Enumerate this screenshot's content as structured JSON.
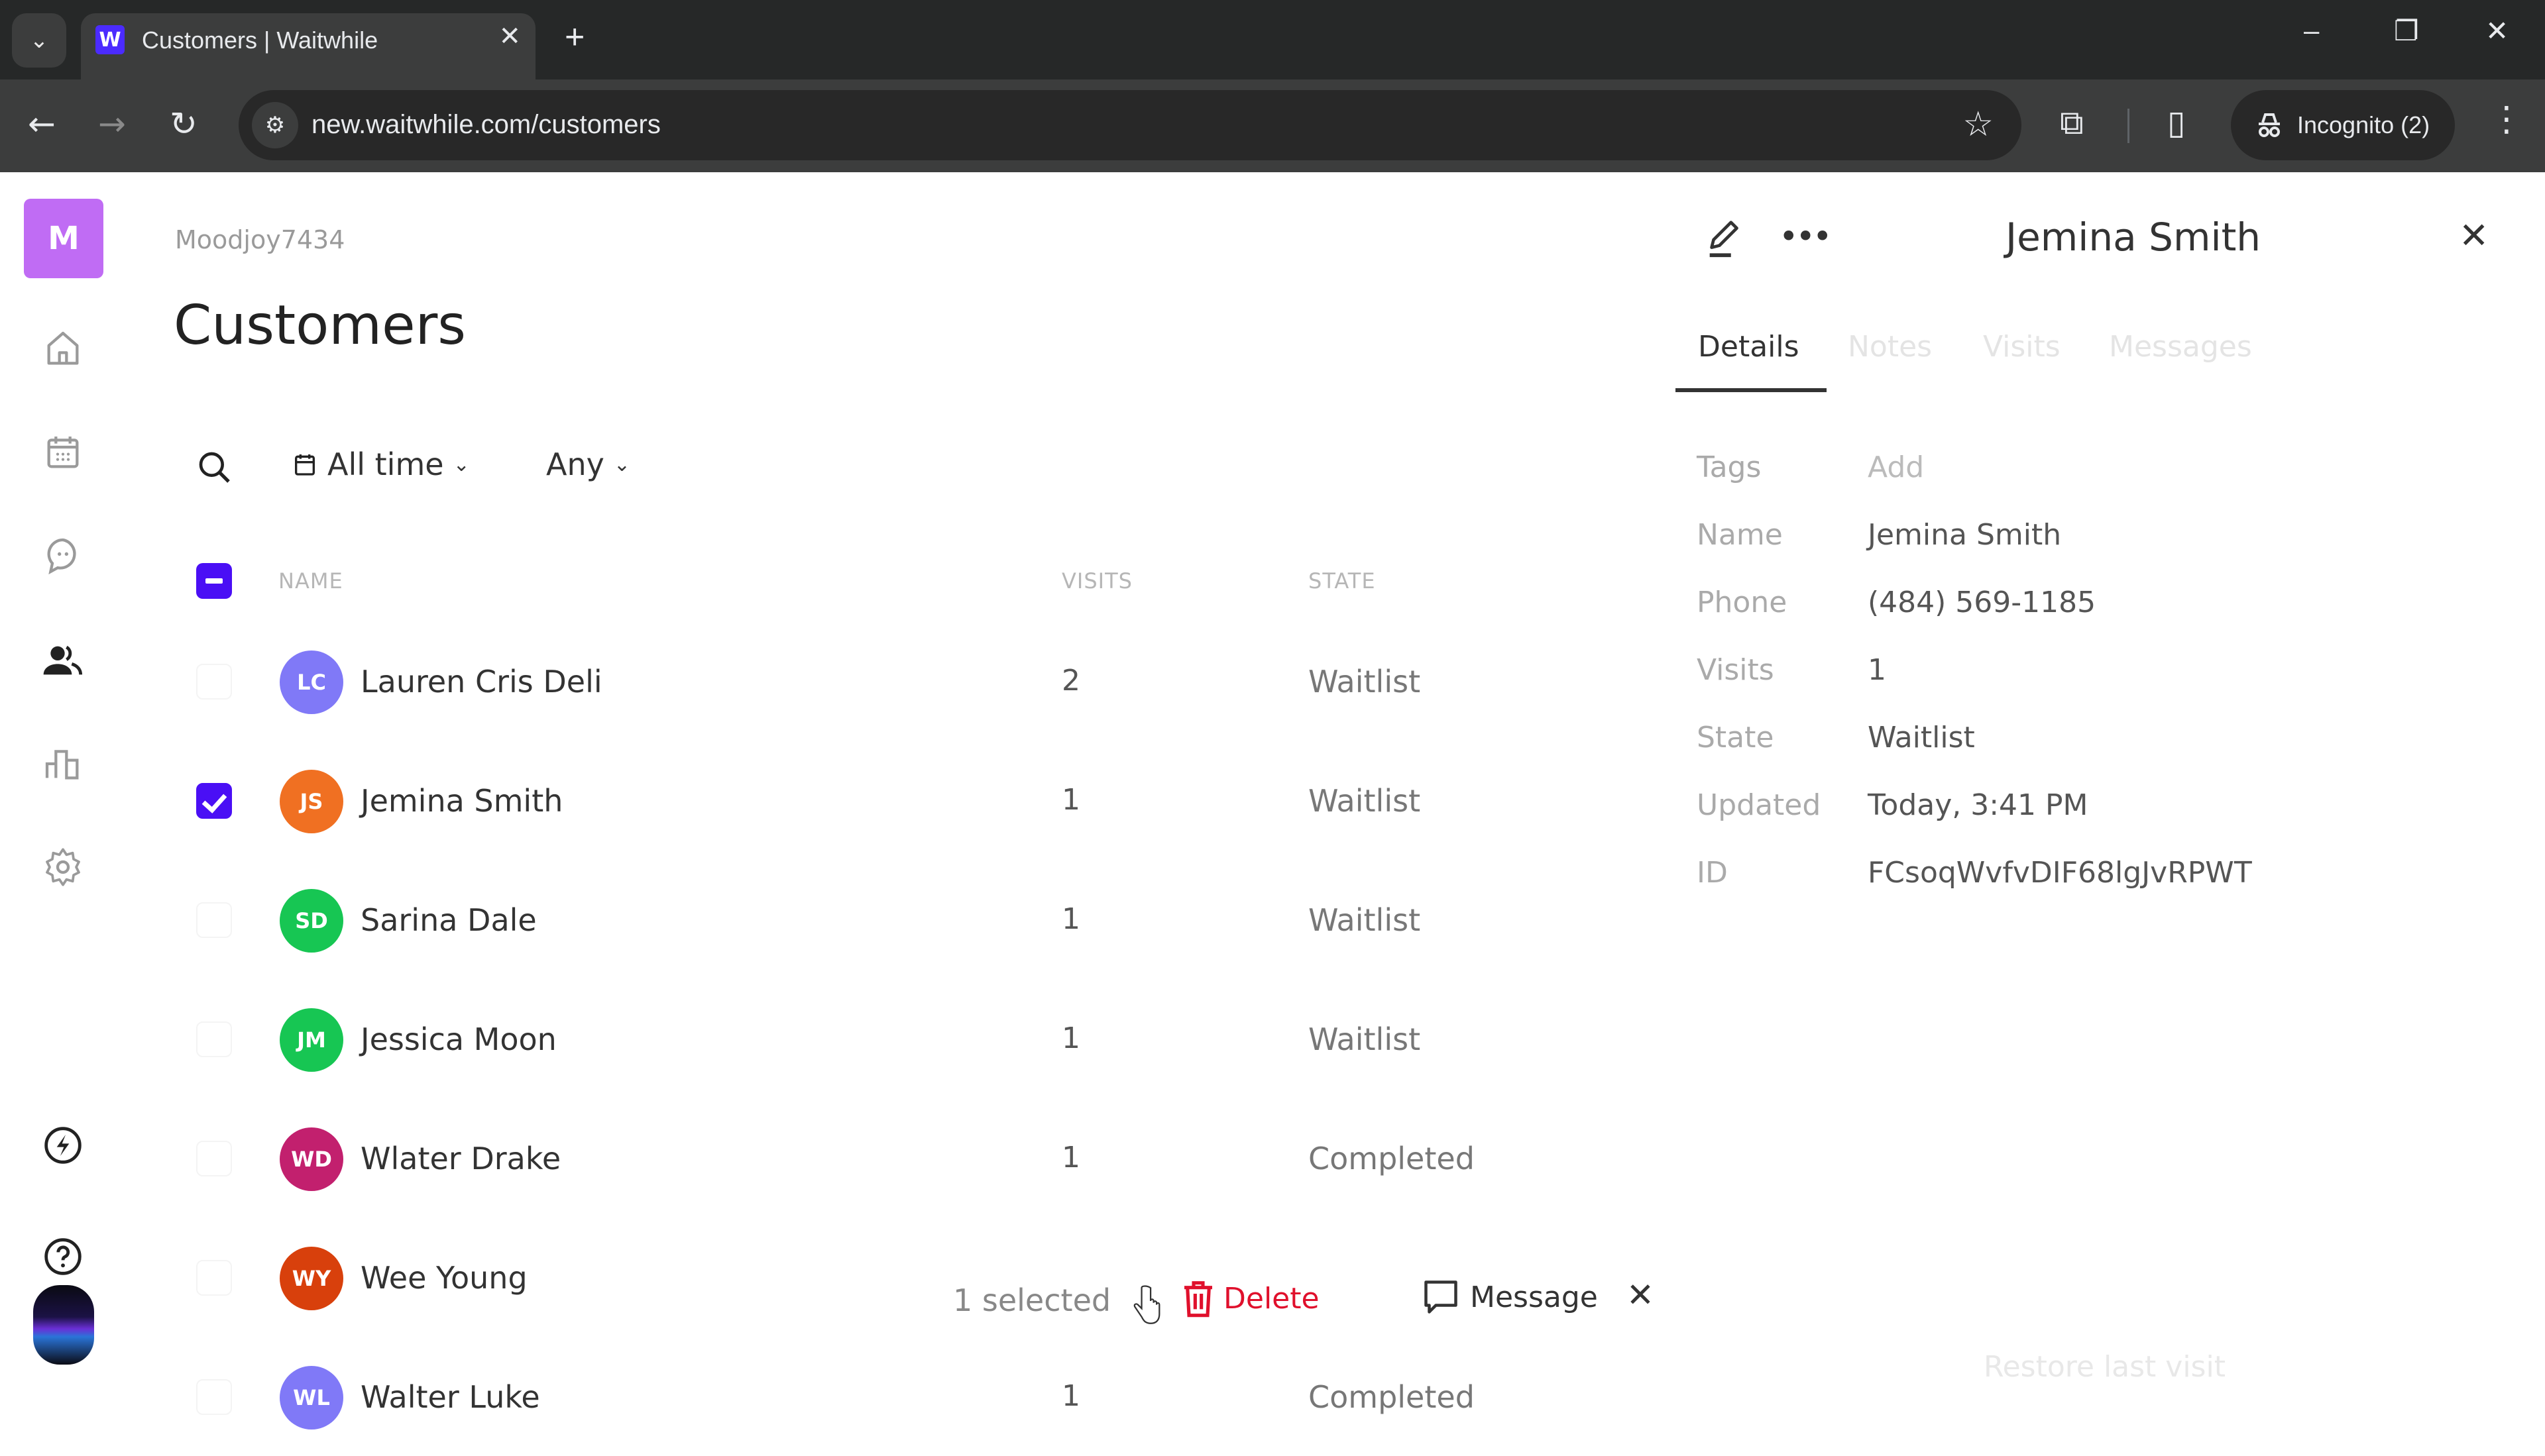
{
  "browser": {
    "tab_title": "Customers | Waitwhile",
    "tab_favicon_letter": "W",
    "url": "new.waitwhile.com/customers",
    "incognito_label": "Incognito (2)",
    "icons": {
      "tab_dropdown": "⌄",
      "tab_close": "✕",
      "new_tab": "+",
      "minimize": "–",
      "restore": "❐",
      "close": "✕",
      "back": "←",
      "forward": "→",
      "reload": "↻",
      "site_info": "⚙",
      "star": "☆",
      "extensions": "⧉",
      "sidepanel": "▯",
      "menu": "⋮"
    }
  },
  "sidebar": {
    "logo_letter": "M",
    "items": [
      {
        "name": "home"
      },
      {
        "name": "calendar"
      },
      {
        "name": "messages"
      },
      {
        "name": "customers",
        "active": true
      },
      {
        "name": "analytics"
      },
      {
        "name": "settings"
      },
      {
        "name": "whats-new"
      },
      {
        "name": "help"
      }
    ]
  },
  "main": {
    "org_name": "Moodjoy7434",
    "title": "Customers",
    "filters": {
      "date_range": "All time",
      "state": "Any"
    },
    "columns": {
      "name": "NAME",
      "visits": "VISITS",
      "state": "STATE"
    },
    "rows": [
      {
        "initials": "LC",
        "name": "Lauren Cris Deli",
        "visits": "2",
        "state": "Waitlist",
        "color": "#8079f7",
        "checked": false
      },
      {
        "initials": "JS",
        "name": "Jemina Smith",
        "visits": "1",
        "state": "Waitlist",
        "color": "#f07022",
        "checked": true
      },
      {
        "initials": "SD",
        "name": "Sarina Dale",
        "visits": "1",
        "state": "Waitlist",
        "color": "#17c653",
        "checked": false
      },
      {
        "initials": "JM",
        "name": "Jessica Moon",
        "visits": "1",
        "state": "Waitlist",
        "color": "#17c653",
        "checked": false
      },
      {
        "initials": "WD",
        "name": "Wlater Drake",
        "visits": "1",
        "state": "Completed",
        "color": "#c2206e",
        "checked": false
      },
      {
        "initials": "WY",
        "name": "Wee Young",
        "visits": "",
        "state": "",
        "color": "#d8400c",
        "checked": false
      },
      {
        "initials": "WL",
        "name": "Walter Luke",
        "visits": "1",
        "state": "Completed",
        "color": "#8079f7",
        "checked": false
      }
    ],
    "bulk_bar": {
      "selected_text": "1 selected",
      "delete_label": "Delete",
      "message_label": "Message",
      "close_icon": "✕"
    }
  },
  "panel": {
    "title": "Jemina Smith",
    "more_icon": "•••",
    "close_icon": "✕",
    "tabs": [
      "Details",
      "Notes",
      "Visits",
      "Messages"
    ],
    "active_tab": "Details",
    "details": [
      {
        "label": "Tags",
        "value": "Add",
        "muted": true
      },
      {
        "label": "Name",
        "value": "Jemina Smith"
      },
      {
        "label": "Phone",
        "value": "(484) 569-1185"
      },
      {
        "label": "Visits",
        "value": "1"
      },
      {
        "label": "State",
        "value": "Waitlist"
      },
      {
        "label": "Updated",
        "value": "Today, 3:41 PM"
      },
      {
        "label": "ID",
        "value": "FCsoqWvfvDIF68lgJvRPWT"
      }
    ],
    "restore_label": "Restore last visit"
  },
  "colors": {
    "accent": "#4a0ff5",
    "logo": "#c06cf4",
    "danger": "#e0102c"
  }
}
